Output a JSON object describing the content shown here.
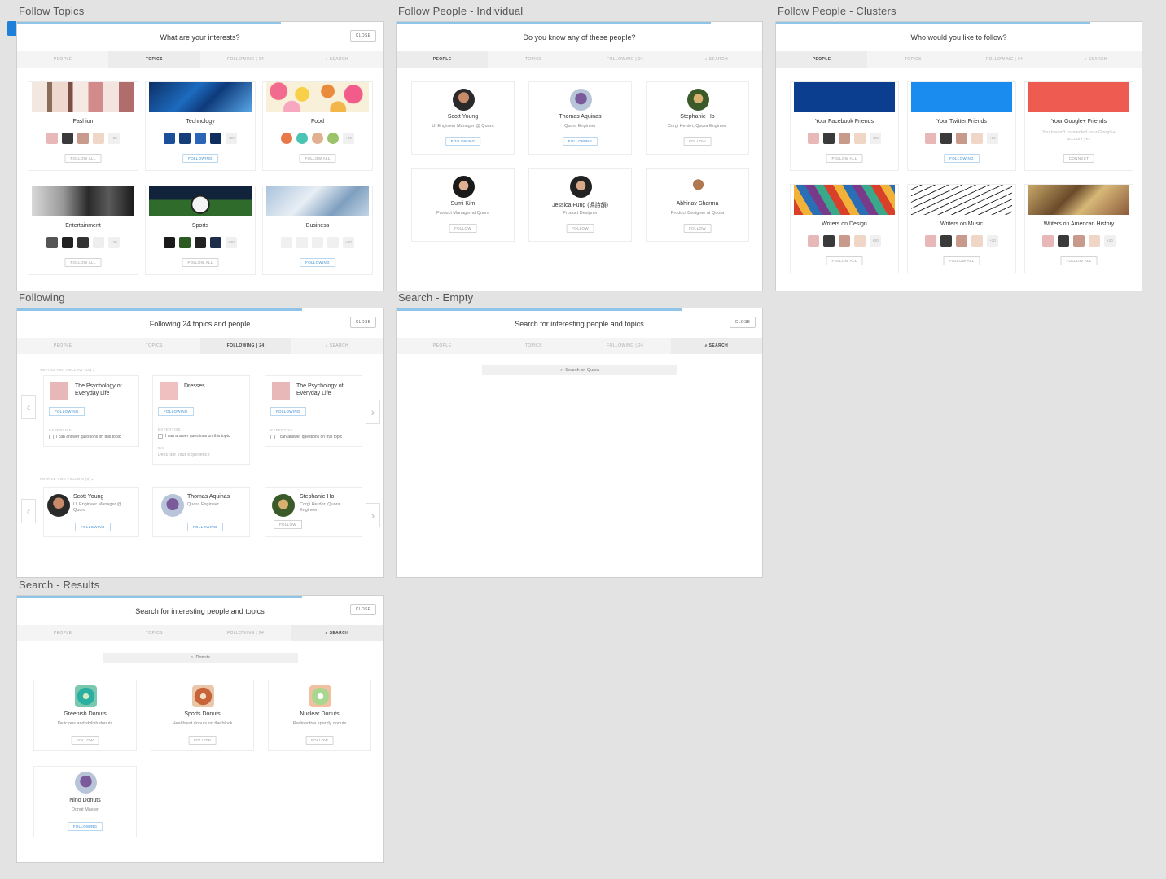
{
  "frames": {
    "follow_topics": {
      "label": "Follow Topics",
      "title": "What are your interests?",
      "close": "CLOSE",
      "tabs": [
        "PEOPLE",
        "TOPICS",
        "FOLLOWING | 24",
        "SEARCH"
      ],
      "cards": [
        {
          "name": "Fashion",
          "button": "FOLLOW ALL"
        },
        {
          "name": "Technology",
          "button": "FOLLOWING"
        },
        {
          "name": "Food",
          "button": "FOLLOW ALL"
        },
        {
          "name": "Entertainment",
          "button": "FOLLOW ALL"
        },
        {
          "name": "Sports",
          "button": "FOLLOW ALL"
        },
        {
          "name": "Business",
          "button": "FOLLOWING"
        }
      ],
      "more_count": "+20"
    },
    "follow_people": {
      "label": "Follow People - Individual",
      "title": "Do you know any of these people?",
      "tabs": [
        "PEOPLE",
        "TOPICS",
        "FOLLOWING | 24",
        "SEARCH"
      ],
      "people": [
        {
          "name": "Scott Young",
          "sub": "UI Engineer Manager @ Quora",
          "button": "FOLLOWING"
        },
        {
          "name": "Thomas Aquinas",
          "sub": "Quora Engineer",
          "button": "FOLLOWING"
        },
        {
          "name": "Stephanie Ho",
          "sub": "Corgi Herder, Quora Engineer",
          "button": "FOLLOW"
        },
        {
          "name": "Sumi Kim",
          "sub": "Product Manager at Quora",
          "button": "FOLLOW"
        },
        {
          "name": "Jessica Fung (馮詩韻)",
          "sub": "Product Designer",
          "button": "FOLLOW"
        },
        {
          "name": "Abhinav Sharma",
          "sub": "Product Designer at Quora",
          "button": "FOLLOW"
        }
      ]
    },
    "follow_clusters": {
      "label": "Follow People - Clusters",
      "title": "Who would you like to follow?",
      "tabs": [
        "PEOPLE",
        "TOPICS",
        "FOLLOWING | 24",
        "SEARCH"
      ],
      "cards": [
        {
          "name": "Your Facebook Friends",
          "button": "FOLLOW ALL"
        },
        {
          "name": "Your Twitter Friends",
          "button": "FOLLOWING"
        },
        {
          "name": "Your Google+ Friends",
          "sub": "You haven't connected your Google+ account yet.",
          "button": "CONNECT"
        },
        {
          "name": "Writers on Design",
          "button": "FOLLOW ALL"
        },
        {
          "name": "Writers on Music",
          "button": "FOLLOW ALL"
        },
        {
          "name": "Writers on American History",
          "button": "FOLLOW ALL"
        }
      ],
      "more_count": "+20"
    },
    "following": {
      "label": "Following",
      "title": "Following 24 topics and people",
      "close": "CLOSE",
      "tabs": [
        "PEOPLE",
        "TOPICS",
        "FOLLOWING | 24",
        "SEARCH"
      ],
      "topics_label": "TOPICS YOU FOLLOW (19) ▸",
      "people_label": "PEOPLE YOU FOLLOW (8) ▸",
      "expertise_label": "EXPERTISE",
      "expertise_text": "I can answer questions on this topic",
      "bio_label": "BIO",
      "bio_placeholder": "Describe your experience",
      "topics": [
        {
          "name": "The Psychology of Everyday Life",
          "button": "FOLLOWING"
        },
        {
          "name": "Dresses",
          "button": "FOLLOWING"
        },
        {
          "name": "The Psychology of Everyday Life",
          "button": "FOLLOWING"
        }
      ],
      "people": [
        {
          "name": "Scott Young",
          "sub": "UI Engineer Manager @ Quora",
          "button": "FOLLOWING"
        },
        {
          "name": "Thomas Aquinas",
          "sub": "Quora Engineer",
          "button": "FOLLOWING"
        },
        {
          "name": "Stephanie Ho",
          "sub": "Corgi Herder, Quora Engineer",
          "button": "FOLLOW"
        }
      ]
    },
    "search_empty": {
      "label": "Search - Empty",
      "title": "Search for interesting people and topics",
      "close": "CLOSE",
      "tabs": [
        "PEOPLE",
        "TOPICS",
        "FOLLOWING | 24",
        "SEARCH"
      ],
      "placeholder": "Search on Quora"
    },
    "search_results": {
      "label": "Search - Results",
      "title": "Search for interesting people and topics",
      "close": "CLOSE",
      "tabs": [
        "PEOPLE",
        "TOPICS",
        "FOLLOWING | 24",
        "SEARCH"
      ],
      "query": "Donuts",
      "results": [
        {
          "name": "Greenish Donuts",
          "sub": "Delicious and stylish donuts",
          "button": "FOLLOW"
        },
        {
          "name": "Sports Donuts",
          "sub": "Healthiest donuts on the block",
          "button": "FOLLOW"
        },
        {
          "name": "Nuclear Donuts",
          "sub": "Radioactive sparkly donuts",
          "button": "FOLLOW"
        },
        {
          "name": "Nino Donuts",
          "sub": "Donut Master",
          "button": "FOLLOWING"
        }
      ]
    }
  },
  "colors": {
    "accent": "#3b8fd4",
    "progress": "#8ec4e8",
    "facebook": "#0b3e8f",
    "twitter": "#1a8cf0",
    "google": "#ee5b50"
  }
}
